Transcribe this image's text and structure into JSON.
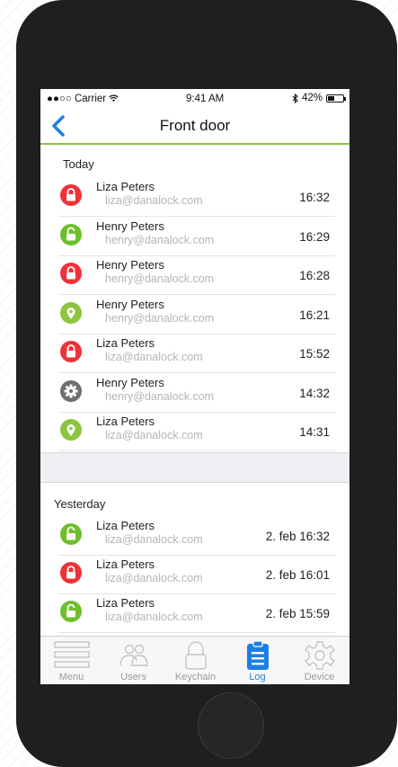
{
  "status_bar": {
    "carrier": "●●○○ Carrier",
    "time": "9:41 AM",
    "battery": "42%",
    "battery_level": 0.42
  },
  "nav": {
    "title": "Front door"
  },
  "colors": {
    "accent": "#8cc63f",
    "lock_red": "#f0313a",
    "unlock_green": "#6fbf2d",
    "gray": "#6f6f6f",
    "tab_active": "#1d7fe6"
  },
  "today": {
    "header": "Today",
    "rows": [
      {
        "name": "Liza Peters",
        "email": "liza@danalock.com",
        "time": "16:32",
        "icon": "lock-icon"
      },
      {
        "name": "Henry Peters",
        "email": "henry@danalock.com",
        "time": "16:29",
        "icon": "unlock-icon"
      },
      {
        "name": "Henry Peters",
        "email": "henry@danalock.com",
        "time": "16:28",
        "icon": "lock-icon"
      },
      {
        "name": "Henry Peters",
        "email": "henry@danalock.com",
        "time": "16:21",
        "icon": "location-pin-icon"
      },
      {
        "name": "Liza Peters",
        "email": "liza@danalock.com",
        "time": "15:52",
        "icon": "lock-icon"
      },
      {
        "name": "Henry Peters",
        "email": "henry@danalock.com",
        "time": "14:32",
        "icon": "gear-icon"
      },
      {
        "name": "Liza Peters",
        "email": "liza@danalock.com",
        "time": "14:31",
        "icon": "location-pin-icon"
      }
    ]
  },
  "yesterday": {
    "header": "Yesterday",
    "rows": [
      {
        "name": "Liza Peters",
        "email": "liza@danalock.com",
        "time": "2. feb  16:32",
        "icon": "unlock-icon"
      },
      {
        "name": "Liza Peters",
        "email": "liza@danalock.com",
        "time": "2. feb  16:01",
        "icon": "lock-icon"
      },
      {
        "name": "Liza Peters",
        "email": "liza@danalock.com",
        "time": "2. feb  15:59",
        "icon": "unlock-icon"
      }
    ]
  },
  "tabs": [
    {
      "label": "Menu",
      "icon": "menu-icon"
    },
    {
      "label": "Users",
      "icon": "users-icon"
    },
    {
      "label": "Keychain",
      "icon": "padlock-icon"
    },
    {
      "label": "Log",
      "icon": "clipboard-icon"
    },
    {
      "label": "Device",
      "icon": "gear-icon"
    }
  ],
  "active_tab": "Log"
}
